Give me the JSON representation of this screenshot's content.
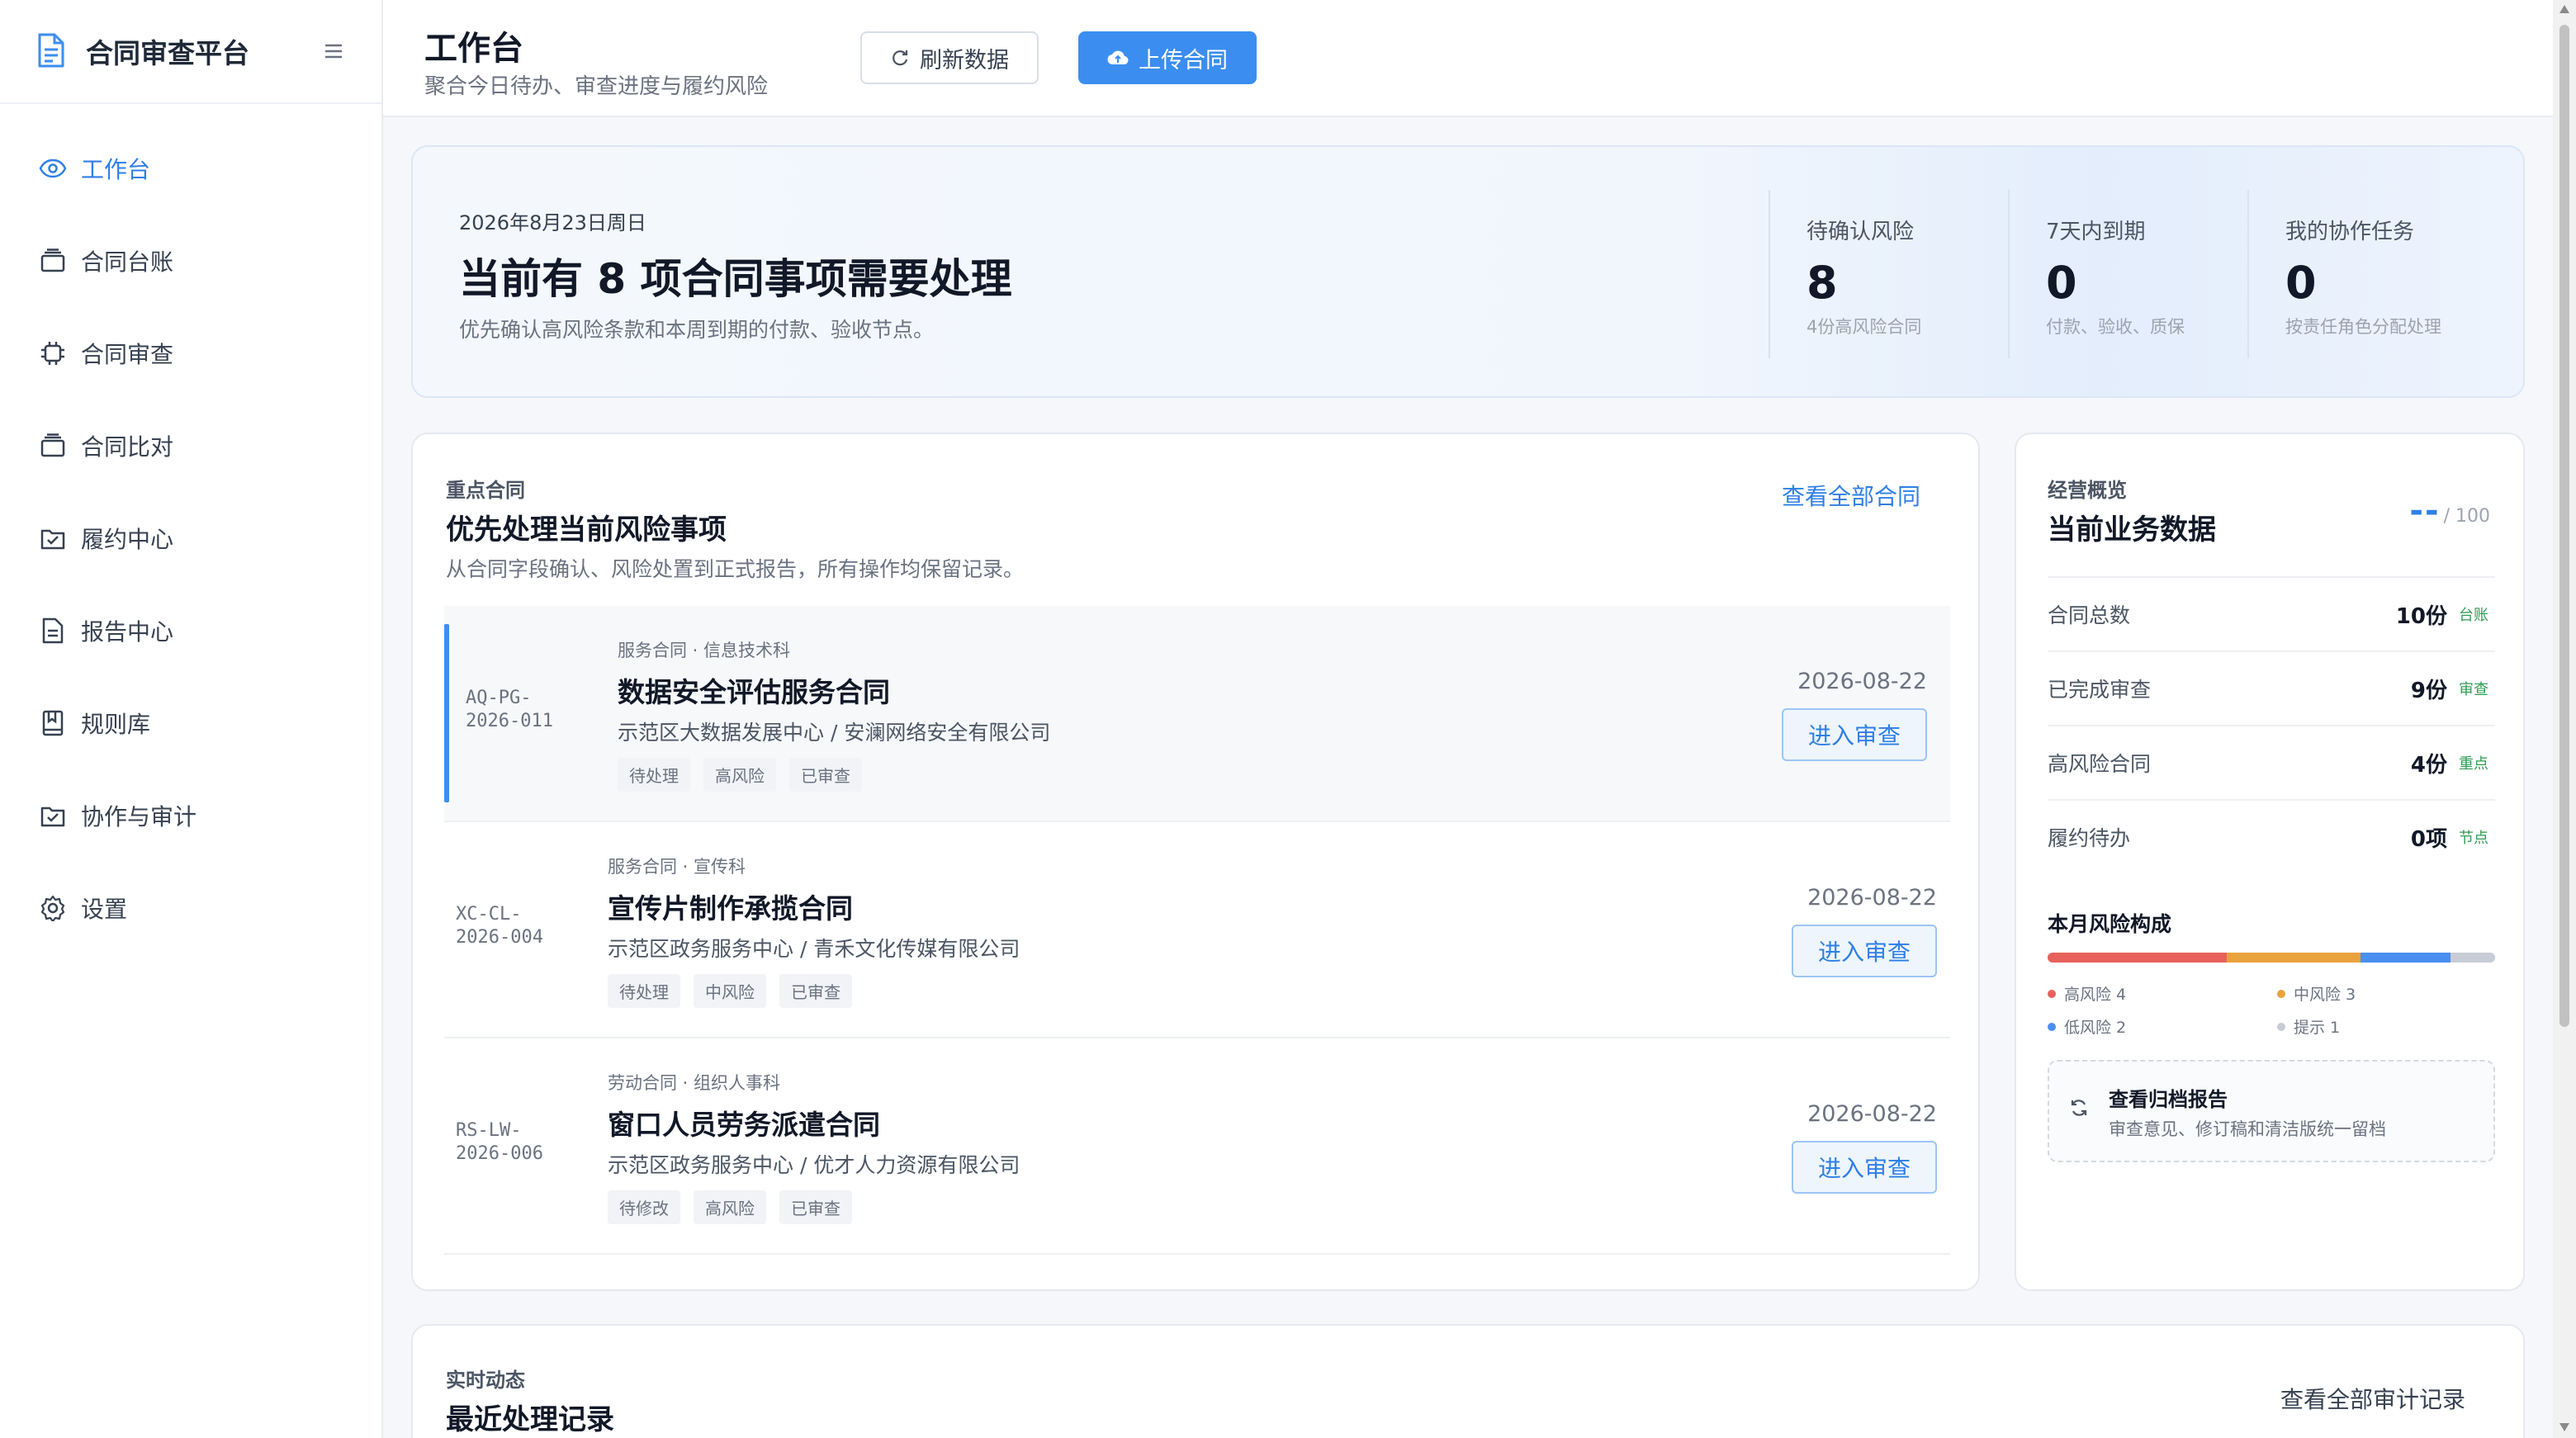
{
  "brand": {
    "name": "合同审查平台"
  },
  "nav": [
    {
      "label": "工作台",
      "icon": "eye-icon",
      "active": true
    },
    {
      "label": "合同台账",
      "icon": "ledger-icon"
    },
    {
      "label": "合同审查",
      "icon": "chip-icon"
    },
    {
      "label": "合同比对",
      "icon": "compare-icon"
    },
    {
      "label": "履约中心",
      "icon": "check-box-icon"
    },
    {
      "label": "报告中心",
      "icon": "document-icon"
    },
    {
      "label": "规则库",
      "icon": "book-icon"
    },
    {
      "label": "协作与审计",
      "icon": "audit-icon"
    },
    {
      "label": "设置",
      "icon": "gear-icon"
    }
  ],
  "header": {
    "title": "工作台",
    "subtitle": "聚合今日待办、审查进度与履约风险",
    "refresh_label": "刷新数据",
    "upload_label": "上传合同"
  },
  "hero": {
    "date": "2026年8月23日周日",
    "title": "当前有 8 项合同事项需要处理",
    "desc": "优先确认高风险条款和本周到期的付款、验收节点。",
    "stats": [
      {
        "label": "待确认风险",
        "value": "8",
        "note": "4份高风险合同"
      },
      {
        "label": "7天内到期",
        "value": "0",
        "note": "付款、验收、质保"
      },
      {
        "label": "我的协作任务",
        "value": "0",
        "note": "按责任角色分配处理"
      }
    ]
  },
  "key_contracts": {
    "kicker": "重点合同",
    "title": "优先处理当前风险事项",
    "desc": "从合同字段确认、风险处置到正式报告，所有操作均保留记录。",
    "view_all": "查看全部合同",
    "enter_label": "进入审查",
    "items": [
      {
        "code1": "AQ-PG-",
        "code2": "2026-011",
        "meta": "服务合同 · 信息技术科",
        "name": "数据安全评估服务合同",
        "parties": "示范区大数据发展中心 / 安澜网络安全有限公司",
        "tags": [
          "待处理",
          "高风险",
          "已审查"
        ],
        "date": "2026-08-22"
      },
      {
        "code1": "XC-CL-",
        "code2": "2026-004",
        "meta": "服务合同 · 宣传科",
        "name": "宣传片制作承揽合同",
        "parties": "示范区政务服务中心 / 青禾文化传媒有限公司",
        "tags": [
          "待处理",
          "中风险",
          "已审查"
        ],
        "date": "2026-08-22"
      },
      {
        "code1": "RS-LW-",
        "code2": "2026-006",
        "meta": "劳动合同 · 组织人事科",
        "name": "窗口人员劳务派遣合同",
        "parties": "示范区政务服务中心 / 优才人力资源有限公司",
        "tags": [
          "待修改",
          "高风险",
          "已审查"
        ],
        "date": "2026-08-22"
      }
    ]
  },
  "overview": {
    "kicker": "经营概览",
    "title": "当前业务数据",
    "score": "--",
    "score_suffix": "/ 100",
    "metrics": [
      {
        "label": "合同总数",
        "value": "10份",
        "tag": "台账"
      },
      {
        "label": "已完成审查",
        "value": "9份",
        "tag": "审查"
      },
      {
        "label": "高风险合同",
        "value": "4份",
        "tag": "重点"
      },
      {
        "label": "履约待办",
        "value": "0项",
        "tag": "节点"
      }
    ],
    "risk_title": "本月风险构成",
    "risk": [
      {
        "label": "高风险 4",
        "count": 4,
        "color": "#e8615c"
      },
      {
        "label": "中风险 3",
        "count": 3,
        "color": "#e8a33c"
      },
      {
        "label": "低风险 2",
        "count": 2,
        "color": "#4a8ef0"
      },
      {
        "label": "提示 1",
        "count": 1,
        "color": "#c7ccd6"
      }
    ],
    "archive_title": "查看归档报告",
    "archive_desc": "审查意见、修订稿和清洁版统一留档"
  },
  "activity": {
    "kicker": "实时动态",
    "title": "最近处理记录",
    "view_all": "查看全部审计记录"
  }
}
